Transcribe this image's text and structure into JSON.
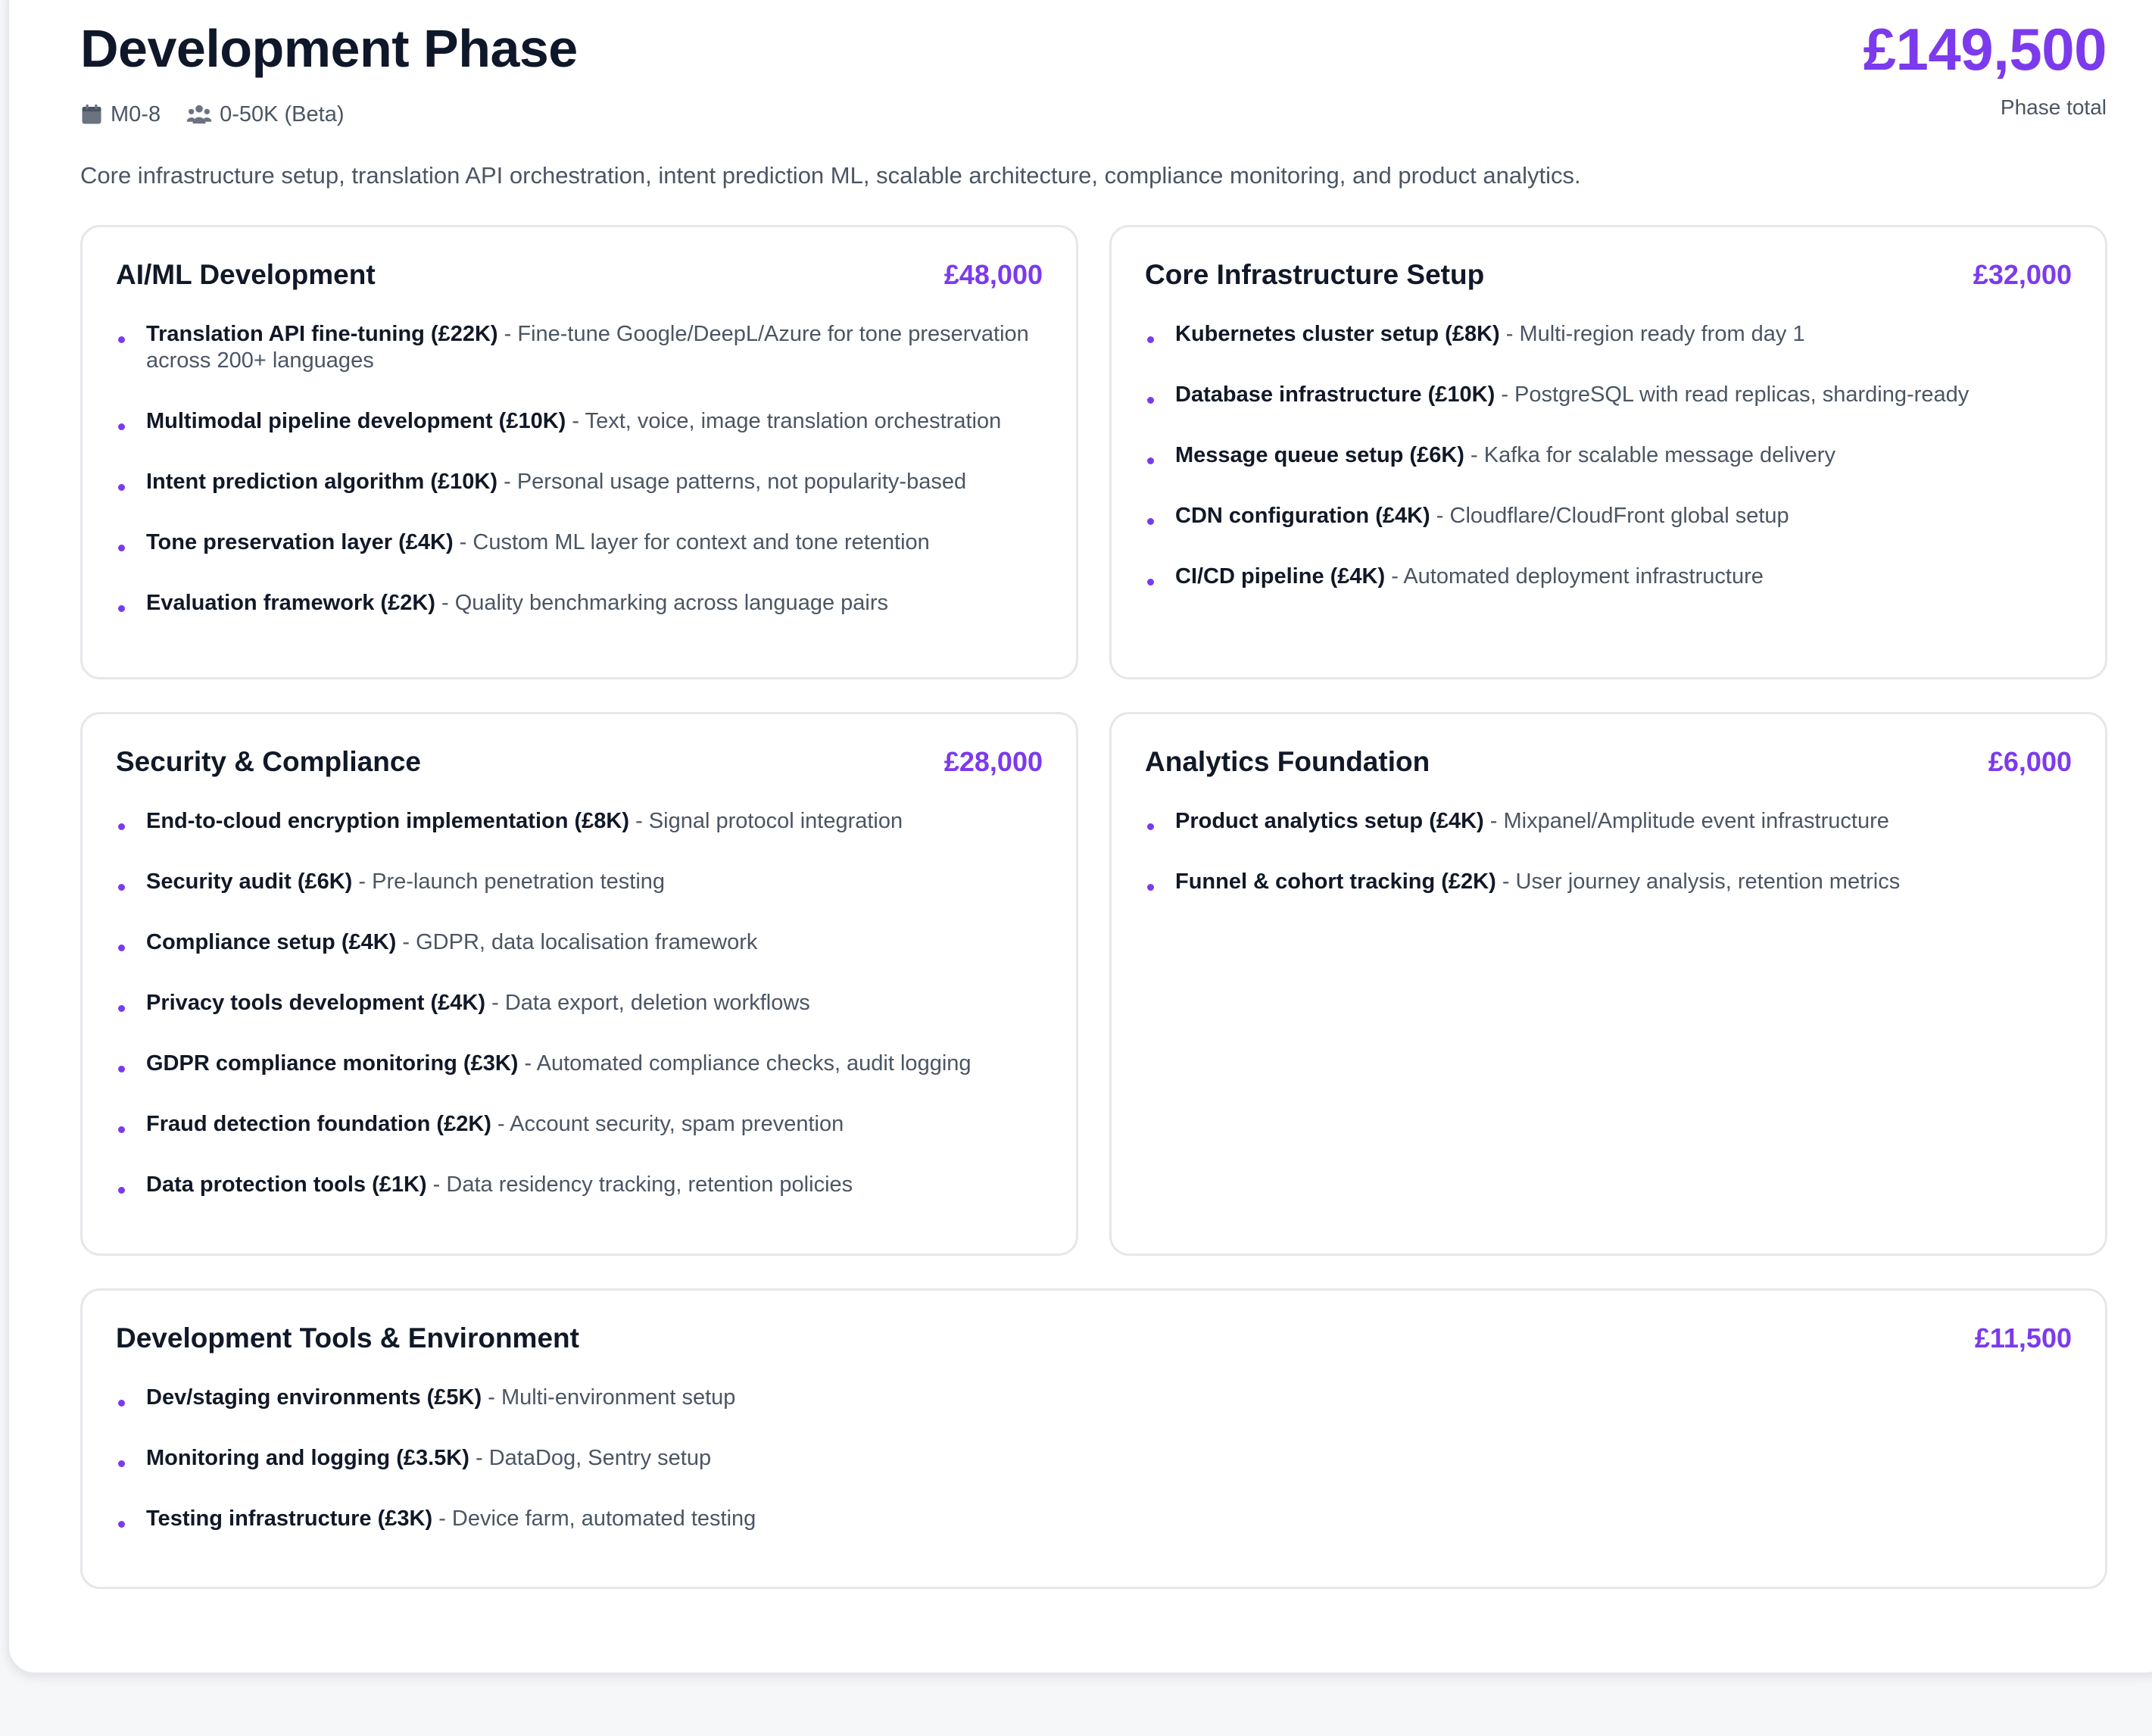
{
  "phase": {
    "title": "Development Phase",
    "meta": [
      {
        "icon": "calendar-icon",
        "text": "M0-8"
      },
      {
        "icon": "users-icon",
        "text": "0-50K (Beta)"
      }
    ],
    "total": "£149,500",
    "total_label": "Phase total",
    "description": "Core infrastructure setup, translation API orchestration, intent prediction ML, scalable architecture, compliance monitoring, and product analytics."
  },
  "colors": {
    "accent": "#7c3aed",
    "text": "#111827",
    "muted": "#4b5563",
    "border": "#e5e7eb"
  },
  "sections": {
    "aiml": {
      "title": "AI/ML Development",
      "cost": "£48,000",
      "items": [
        {
          "name": "Translation API fine-tuning (£22K)",
          "desc": "Fine-tune Google/DeepL/Azure for tone preservation across 200+ languages"
        },
        {
          "name": "Multimodal pipeline development (£10K)",
          "desc": "Text, voice, image translation orchestration"
        },
        {
          "name": "Intent prediction algorithm (£10K)",
          "desc": "Personal usage patterns, not popularity-based"
        },
        {
          "name": "Tone preservation layer (£4K)",
          "desc": "Custom ML layer for context and tone retention"
        },
        {
          "name": "Evaluation framework (£2K)",
          "desc": "Quality benchmarking across language pairs"
        }
      ]
    },
    "infra": {
      "title": "Core Infrastructure Setup",
      "cost": "£32,000",
      "items": [
        {
          "name": "Kubernetes cluster setup (£8K)",
          "desc": "Multi-region ready from day 1"
        },
        {
          "name": "Database infrastructure (£10K)",
          "desc": "PostgreSQL with read replicas, sharding-ready"
        },
        {
          "name": "Message queue setup (£6K)",
          "desc": "Kafka for scalable message delivery"
        },
        {
          "name": "CDN configuration (£4K)",
          "desc": "Cloudflare/CloudFront global setup"
        },
        {
          "name": "CI/CD pipeline (£4K)",
          "desc": "Automated deployment infrastructure"
        }
      ]
    },
    "security": {
      "title": "Security & Compliance",
      "cost": "£28,000",
      "items": [
        {
          "name": "End-to-cloud encryption implementation (£8K)",
          "desc": "Signal protocol integration"
        },
        {
          "name": "Security audit (£6K)",
          "desc": "Pre-launch penetration testing"
        },
        {
          "name": "Compliance setup (£4K)",
          "desc": "GDPR, data localisation framework"
        },
        {
          "name": "Privacy tools development (£4K)",
          "desc": "Data export, deletion workflows"
        },
        {
          "name": "GDPR compliance monitoring (£3K)",
          "desc": "Automated compliance checks, audit logging"
        },
        {
          "name": "Fraud detection foundation (£2K)",
          "desc": "Account security, spam prevention"
        },
        {
          "name": "Data protection tools (£1K)",
          "desc": "Data residency tracking, retention policies"
        }
      ]
    },
    "analytics": {
      "title": "Analytics Foundation",
      "cost": "£6,000",
      "items": [
        {
          "name": "Product analytics setup (£4K)",
          "desc": "Mixpanel/Amplitude event infrastructure"
        },
        {
          "name": "Funnel & cohort tracking (£2K)",
          "desc": "User journey analysis, retention metrics"
        }
      ]
    },
    "devtools": {
      "title": "Development Tools & Environment",
      "cost": "£11,500",
      "items": [
        {
          "name": "Dev/staging environments (£5K)",
          "desc": "Multi-environment setup"
        },
        {
          "name": "Monitoring and logging (£3.5K)",
          "desc": "DataDog, Sentry setup"
        },
        {
          "name": "Testing infrastructure (£3K)",
          "desc": "Device farm, automated testing"
        }
      ]
    }
  }
}
